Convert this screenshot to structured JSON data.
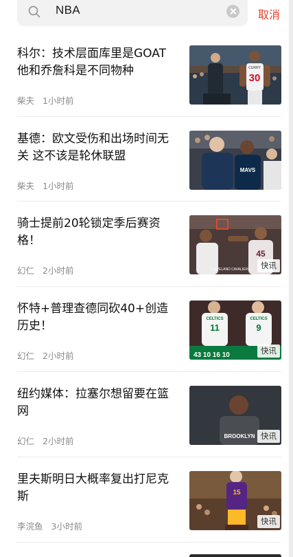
{
  "search": {
    "query": "NBA",
    "cancel_label": "取消"
  },
  "news": [
    {
      "title": "科尔：技术层面库里是GOAT 他和乔詹科是不同物种",
      "author": "柴夫",
      "time": "1小时前",
      "badge": ""
    },
    {
      "title": "基德：欧文受伤和出场时间无关 这不该是轮休联盟",
      "author": "柴夫",
      "time": "1小时前",
      "badge": ""
    },
    {
      "title": "骑士提前20轮锁定季后赛资格！",
      "author": "幻仁",
      "time": "2小时前",
      "badge": "快讯"
    },
    {
      "title": "怀特+普理查德同砍40+创造历史！",
      "author": "幻仁",
      "time": "2小时前",
      "badge": "快讯"
    },
    {
      "title": "纽约媒体：拉塞尔想留要在篮网",
      "author": "幻仁",
      "time": "2小时前",
      "badge": "快讯"
    },
    {
      "title": "里夫斯明日大概率复出打尼克斯",
      "author": "李浣鱼",
      "time": "3小时前",
      "badge": "快讯"
    }
  ],
  "thumb_text": {
    "curry_name": "CURRY",
    "curry_number": "30",
    "mavs": "MAVS",
    "cavs_caption": "CLEVELAND CAVALIERS",
    "celtics_left": "CELTICS",
    "celtics_right": "CELTICS",
    "num_11": "11",
    "num_9": "9",
    "score_strip": "43 10 16 10",
    "brooklyn": "BROOKLYN",
    "lakers_number": "15"
  },
  "colors": {
    "accent": "#e8412e",
    "title_text": "#111111",
    "meta_text": "#8a8a8a"
  }
}
